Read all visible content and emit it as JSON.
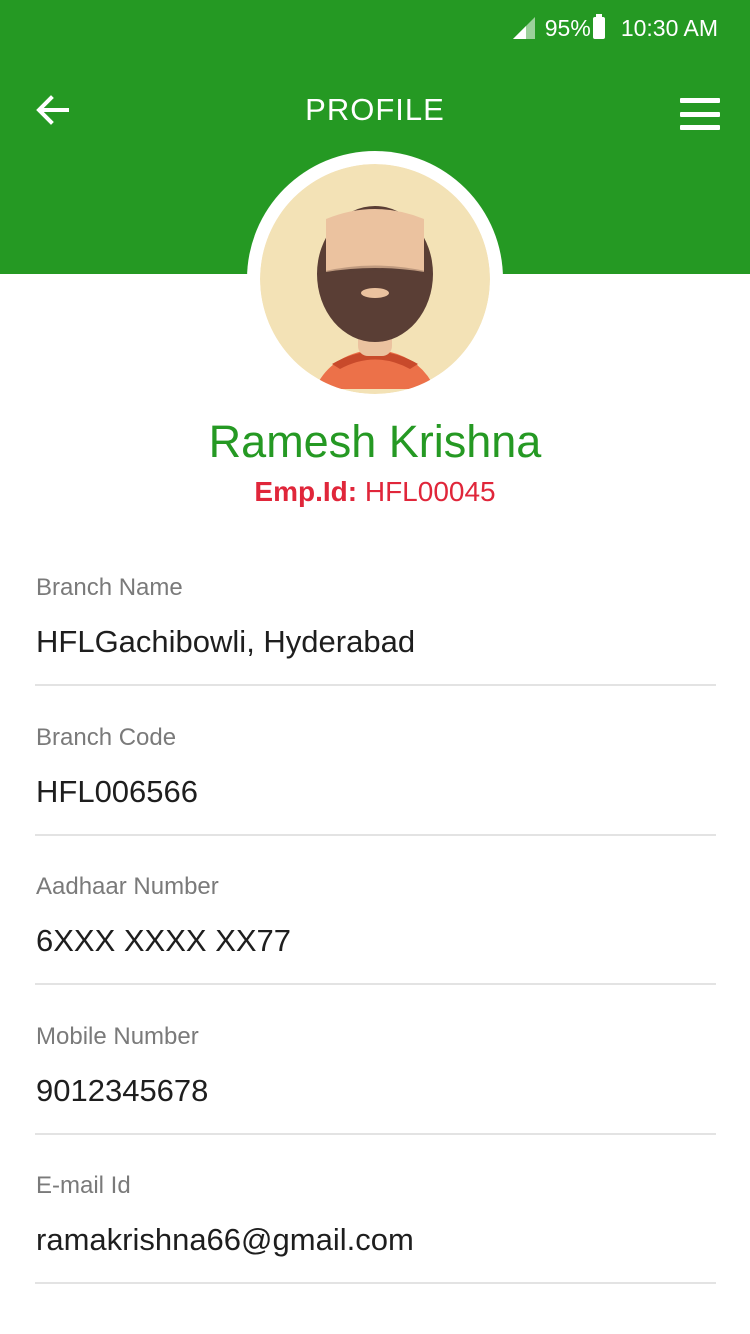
{
  "status_bar": {
    "battery": "95%",
    "time": "10:30 AM",
    "icons": [
      "signal-icon",
      "battery-icon"
    ]
  },
  "header": {
    "title": "PROFILE",
    "back_icon": "back-arrow-icon",
    "menu_icon": "hamburger-menu-icon",
    "color": "#259923"
  },
  "profile": {
    "name": "Ramesh Krishna",
    "emp_id_label": "Emp.Id:",
    "emp_id_value": "HFL00045",
    "name_color": "#259923",
    "emp_id_color": "#e0263a"
  },
  "fields": [
    {
      "label": "Branch Name",
      "value": "HFLGachibowli, Hyderabad"
    },
    {
      "label": "Branch Code",
      "value": "HFL006566"
    },
    {
      "label": "Aadhaar Number",
      "value": "6XXX XXXX XX77"
    },
    {
      "label": "Mobile Number",
      "value": "9012345678"
    },
    {
      "label": "E-mail Id",
      "value": "ramakrishna66@gmail.com"
    }
  ]
}
